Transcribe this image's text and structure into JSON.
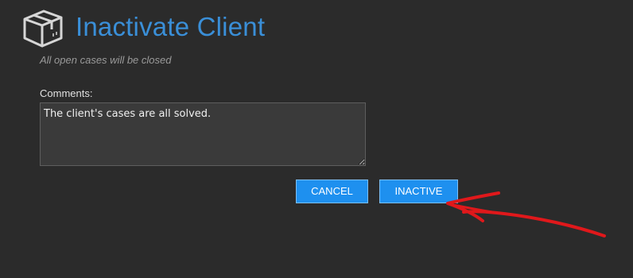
{
  "dialog": {
    "icon": "package-box-icon",
    "title": "Inactivate Client",
    "subtitle": "All open cases will be closed"
  },
  "form": {
    "comments_label": "Comments:",
    "comments_value": "The client's cases are all solved."
  },
  "actions": {
    "cancel_label": "CANCEL",
    "inactive_label": "INACTIVE"
  },
  "annotation": {
    "icon": "red-arrow-icon",
    "color": "#e0181b"
  },
  "colors": {
    "background": "#2b2b2b",
    "title": "#3a8fd8",
    "button": "#1e90ef",
    "button_border": "#7cc0f7"
  }
}
